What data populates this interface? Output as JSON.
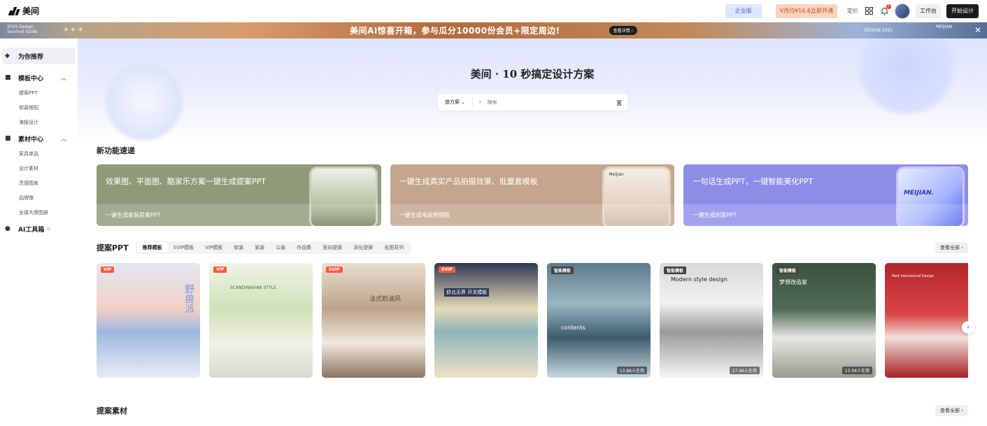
{
  "header": {
    "logo_text": "美间",
    "enterprise_label": "企业版",
    "vip_label": "V月均¥16.6立即开通",
    "pricing_label": "定价",
    "notification_count": "1",
    "workbench_label": "工作台",
    "start_design_label": "开始设计"
  },
  "banner": {
    "left_line1": "2025 Design",
    "left_line2": "Survival Guide",
    "left_plus": "+++",
    "text": "美间AI惊喜开箱，参与瓜分10000份会员+限定周边!",
    "button_label": "查看详情 ›",
    "right_text": "DESIGN 2025",
    "right_text2": "MEIJIAN"
  },
  "sidebar": {
    "items": [
      {
        "label": "为你推荐",
        "icon": "star-icon"
      },
      {
        "label": "模板中心",
        "icon": "template-icon",
        "children": [
          "提案PPT",
          "软装搭配",
          "海报设计"
        ]
      },
      {
        "label": "素材中心",
        "icon": "material-icon",
        "children": [
          "家具单品",
          "设计素材",
          "灵感图库",
          "品牌馆",
          "全球大牌图册"
        ]
      },
      {
        "label": "AI工具箱",
        "icon": "ai-icon"
      }
    ]
  },
  "hero": {
    "title": "美间 · 10 秒搞定设计方案",
    "search_select": "提方案",
    "search_placeholder": "搜索"
  },
  "features": {
    "title": "新功能速递",
    "items": [
      {
        "title": "效果图、平面图、酷家乐方案一键生成提案PPT",
        "subtitle": "一键生成家装提案PPT",
        "color": "#8f9a79"
      },
      {
        "title": "一键生成真实产品拍摄效果、批量套模板",
        "subtitle": "一键生成电商营销图",
        "color": "#c3a68d",
        "image_label": "Meijian"
      },
      {
        "title": "一句话生成PPT，一键智能美化PPT",
        "subtitle": "一键生成创意PPT",
        "color": "#8d8de8",
        "image_label": "MEIJIAN."
      }
    ]
  },
  "proposal": {
    "title": "提案PPT",
    "tabs": [
      "推荐模板",
      "SVIP模板",
      "VIP模板",
      "软装",
      "家装",
      "公装",
      "作品集",
      "竞向提案",
      "深化提案",
      "名图系列"
    ],
    "see_all": "查看全部 ›",
    "cards": [
      {
        "badge": "VIP",
        "count": "",
        "text": "野兽派"
      },
      {
        "badge": "VIP",
        "count": "",
        "text": "SCANDINAVIAN STYLE"
      },
      {
        "badge": "SVIP",
        "count": "",
        "text": "法式奶油风"
      },
      {
        "badge": "SVIP",
        "count": "",
        "text": "舒北无界 开关模板"
      },
      {
        "badge": "智能模板",
        "count": "13.9K人在用",
        "text": "contents"
      },
      {
        "badge": "智能模板",
        "count": "17.4K人在用",
        "text": "Modern style design"
      },
      {
        "badge": "智能模板",
        "count": "13.5K人在用",
        "text": "梦想改造家"
      },
      {
        "badge": "",
        "count": "",
        "text": "Rest Interational Design"
      }
    ]
  },
  "materials": {
    "title": "提案素材",
    "see_all": "查看全部 ›"
  }
}
